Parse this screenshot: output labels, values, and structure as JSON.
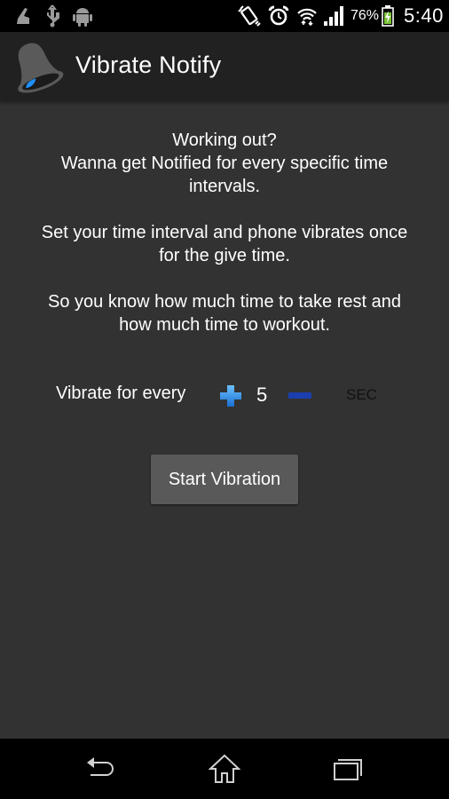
{
  "status_bar": {
    "left_icons": [
      "cleaner-broom-icon",
      "usb-icon",
      "android-debug-icon"
    ],
    "right_icons": [
      "vibrate-mode-icon",
      "alarm-clock-icon",
      "wifi-icon",
      "signal-icon",
      "battery-charging-icon"
    ],
    "battery_percent": "76%",
    "time": "5:40"
  },
  "action_bar": {
    "app_icon": "bell-icon",
    "title": "Vibrate Notify"
  },
  "content": {
    "intro_lines": [
      "Working out?",
      "Wanna get Notified for every specific time",
      "intervals."
    ],
    "description_lines": [
      "Set your time interval and phone vibrates once",
      "for the give time."
    ],
    "benefit_lines": [
      "So you know how much time to take rest and",
      "how much time to workout."
    ],
    "interval": {
      "label": "Vibrate for every",
      "value": "5",
      "unit": "SEC",
      "increment_icon": "plus-icon",
      "decrement_icon": "minus-icon"
    },
    "start_button_label": "Start Vibration"
  },
  "nav_bar": {
    "buttons": [
      "back-icon",
      "home-icon",
      "recents-icon"
    ]
  },
  "colors": {
    "status_bar_bg": "#000000",
    "action_bar_bg": "#212121",
    "content_bg": "#323232",
    "button_bg": "#595959",
    "plus_blue": "#2f8fe0",
    "minus_blue": "#1c3fb0",
    "bell_accent": "#1e90ff"
  }
}
